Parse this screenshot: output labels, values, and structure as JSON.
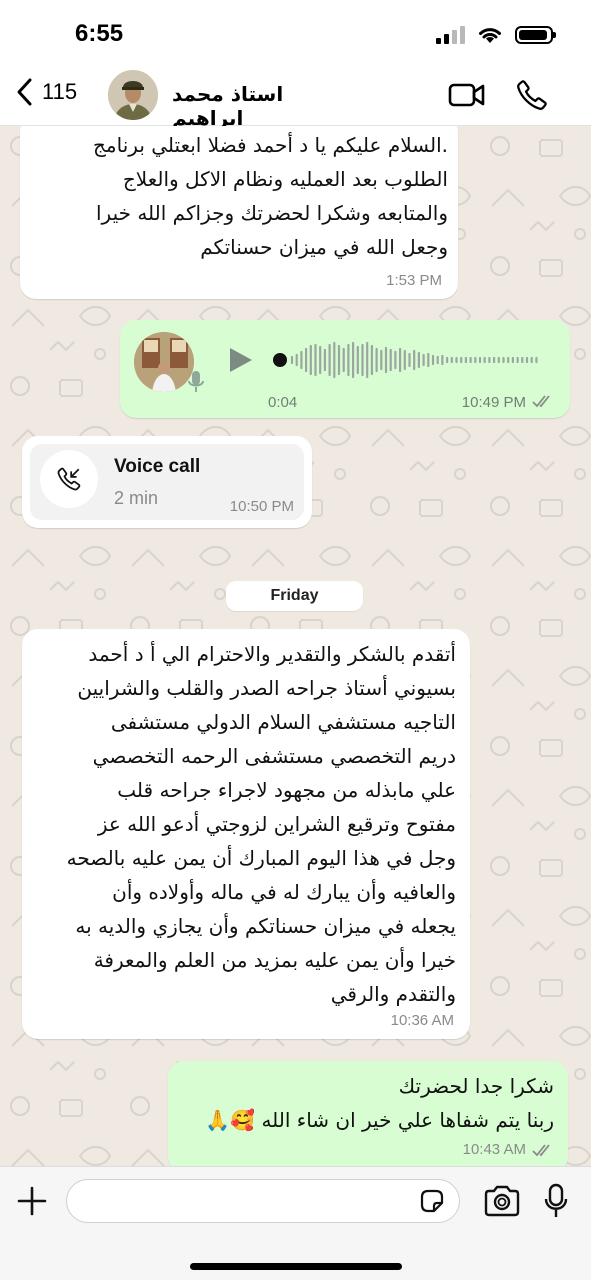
{
  "status_bar": {
    "time": "6:55"
  },
  "header": {
    "back_count": "115",
    "contact_name": "استاذ محمد ابراهيم"
  },
  "messages": {
    "m1": {
      "text": ".السلام عليكم  يا د أحمد  فضلا ابعتلي برنامج\nالطلوب بعد العمليه ونظام الاكل والعلاج\nوالمتابعه وشكرا لحضرتك وجزاكم الله خيرا\nوجعل الله في ميزان حسناتكم",
      "time": "1:53 PM"
    },
    "voice": {
      "duration": "0:04",
      "time": "10:49 PM",
      "progress": 0.0
    },
    "call": {
      "title": "Voice call",
      "duration": "2 min",
      "time": "10:50 PM"
    },
    "date_divider": "Friday",
    "m2": {
      "text": "أتقدم بالشكر والتقدير والاحترام الي أ د أحمد\nبسيوني  أستاذ جراحه الصدر والقلب والشرايين\nالتاجيه  مستشفي السلام الدولي  مستشفى\nدريم التخصصي مستشفى الرحمه التخصصي\nعلي مابذله من مجهود لاجراء جراحه قلب\nمفتوح وترقيع الشراين لزوجتي  أدعو الله عز\nوجل في هذا اليوم المبارك أن يمن عليه بالصحه\nوالعافيه وأن يبارك له في ماله وأولاده وأن\nيجعله في ميزان حسناتكم وأن يجازي والديه به\nخيرا وأن يمن عليه بمزيد من العلم والمعرفة\nوالتقدم والرقي",
      "time": "10:36 AM"
    },
    "m3": {
      "line1": "شكرا جدا لحضرتك",
      "line2": "ربنا يتم شفاها علي خير ان شاء الله 🥰🙏",
      "time": "10:43 AM"
    }
  },
  "composer": {
    "placeholder": ""
  },
  "colors": {
    "incoming": "#ffffff",
    "outgoing": "#d9fdd3",
    "chat_bg": "#efe9e1",
    "read_ticks": "#8a8a8a"
  }
}
